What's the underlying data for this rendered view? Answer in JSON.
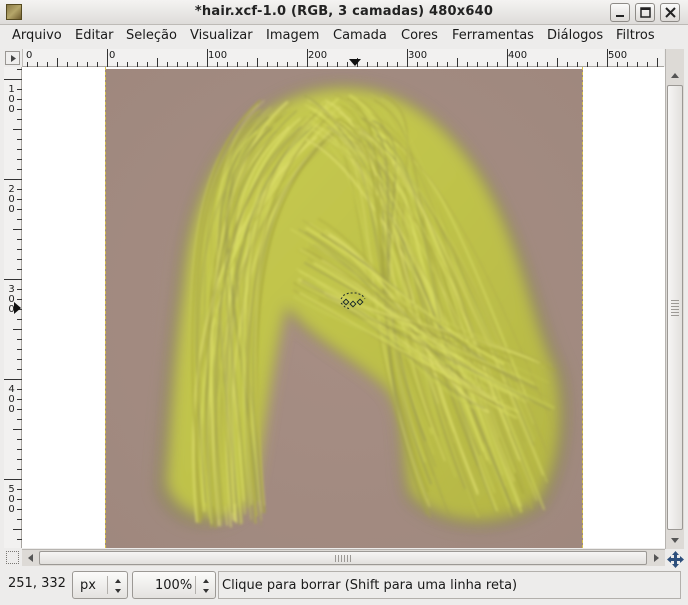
{
  "window": {
    "title": "*hair.xcf-1.0 (RGB, 3 camadas) 480x640"
  },
  "menu": {
    "items": [
      "Arquivo",
      "Editar",
      "Seleção",
      "Visualizar",
      "Imagem",
      "Camada",
      "Cores",
      "Ferramentas",
      "Diálogos",
      "Filtros"
    ]
  },
  "rulers": {
    "horizontal_labels": [
      "0",
      "0",
      "100",
      "200",
      "300",
      "400",
      "500"
    ],
    "vertical_labels": [
      "100",
      "200",
      "300",
      "400",
      "500"
    ]
  },
  "statusbar": {
    "coords": "251, 332",
    "unit": "px",
    "zoom": "100%",
    "message": "Clique para borrar (Shift para uma linha reta)"
  },
  "colors": {
    "canvas_background": "#a58c82",
    "hair": "#c3c64a"
  },
  "icons": {
    "app": "gimp-image-icon",
    "minimize": "minimize-icon",
    "maximize": "maximize-icon",
    "close": "close-icon",
    "navigate": "navigate-icon",
    "quick_mask": "quick-mask-icon"
  }
}
